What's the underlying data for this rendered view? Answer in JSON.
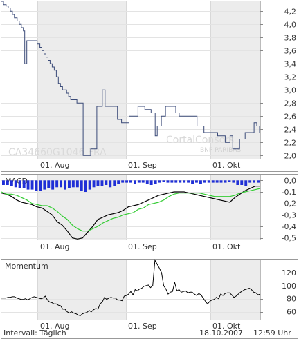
{
  "chart_data": [
    {
      "type": "line",
      "panel": "price",
      "instrument": "CA34660G1046",
      "exchange": "FRA",
      "x_labels": [
        "01. Aug",
        "01. Sep",
        "01. Okt"
      ],
      "y_ticks": [
        "4,2",
        "4,0",
        "3,8",
        "3,6",
        "3,4",
        "3,2",
        "3,0",
        "2,8",
        "2,6",
        "2,4",
        "2,2",
        "2,0"
      ],
      "ylim": [
        1.95,
        4.35
      ],
      "x": [
        0,
        1,
        2,
        3,
        4,
        5,
        6,
        7,
        8,
        9,
        10,
        11,
        12,
        13,
        14,
        15,
        16,
        17,
        18,
        19,
        20,
        21,
        22,
        23,
        24,
        25,
        26,
        27,
        28,
        29,
        30,
        31,
        32,
        33,
        34,
        35,
        36,
        37,
        38,
        39,
        40,
        41,
        42,
        43,
        44,
        45,
        46,
        47,
        48,
        49,
        50,
        51,
        52,
        53,
        54,
        55,
        56,
        57,
        58,
        59,
        60,
        61,
        62,
        63,
        64,
        65,
        66,
        67,
        68,
        69,
        70,
        71,
        72,
        73,
        74,
        75,
        76,
        77,
        78,
        79,
        80,
        81,
        82,
        83,
        84,
        85,
        86,
        87,
        88,
        89,
        90,
        91,
        92,
        93,
        94,
        95,
        96,
        97,
        98,
        99,
        100,
        101,
        102,
        103,
        104,
        105,
        106,
        107,
        108,
        109,
        110,
        111,
        112,
        113,
        114,
        115,
        116,
        117,
        118,
        119,
        120,
        121,
        122,
        123,
        124,
        125,
        126,
        127,
        128,
        129,
        130,
        131,
        132,
        133,
        134,
        135,
        136,
        137,
        138,
        139,
        140,
        141,
        142,
        143,
        144,
        145,
        146,
        147,
        148,
        149,
        150,
        151,
        152,
        153,
        154,
        155,
        156,
        157,
        158,
        159,
        160,
        161,
        162,
        163,
        164,
        165,
        166,
        167,
        168,
        169,
        170,
        171,
        172,
        173,
        174,
        175,
        176,
        177,
        178,
        179,
        180,
        181,
        182,
        183,
        184,
        185,
        186,
        187,
        188,
        189,
        190,
        191,
        192,
        193,
        194,
        195,
        196,
        197,
        198,
        199,
        200,
        201,
        202,
        203,
        204,
        205,
        206,
        207,
        208,
        209,
        210,
        211,
        212,
        213,
        214,
        215,
        216,
        217,
        218,
        219,
        220,
        221,
        222,
        223,
        224,
        225,
        226,
        227,
        228,
        229,
        230,
        231,
        232,
        233,
        234,
        235,
        236,
        237,
        238,
        239,
        240,
        241,
        242,
        243,
        244,
        245,
        246,
        247,
        248,
        249,
        250,
        251,
        252,
        253,
        254,
        255,
        256,
        257,
        258,
        259,
        260,
        261,
        262,
        263,
        264,
        265,
        266,
        267,
        268,
        269,
        270,
        271,
        272,
        273,
        274,
        275,
        276,
        277,
        278,
        279,
        280,
        281,
        282,
        283,
        284,
        285,
        286,
        287,
        288,
        289,
        290,
        291,
        292,
        293,
        294,
        295,
        296,
        297,
        298,
        299,
        300,
        301,
        302,
        303,
        304,
        305,
        306,
        307,
        308,
        309,
        310,
        311,
        312,
        313,
        314,
        315,
        316,
        317,
        318,
        319,
        320,
        321,
        322,
        323,
        324,
        325,
        326,
        327,
        328,
        329,
        330,
        331,
        332,
        333,
        334,
        335,
        336,
        337,
        338,
        339,
        340,
        341,
        342,
        343,
        344,
        345,
        346,
        347,
        348,
        349,
        350,
        351,
        352,
        353,
        354,
        355,
        356,
        357,
        358,
        359,
        360,
        361,
        362,
        363,
        364,
        365,
        366,
        367,
        368,
        369,
        370,
        371,
        372,
        373
      ],
      "values": [
        4.35,
        4.35,
        4.35,
        4.3,
        4.3,
        4.3,
        4.3,
        4.28,
        4.28,
        4.28,
        4.25,
        4.25,
        4.25,
        4.2,
        4.2,
        4.2,
        4.15,
        4.15,
        4.15,
        4.1,
        4.1,
        4.1,
        4.1,
        4.05,
        4.05,
        4.05,
        4.0,
        4.0,
        4.0,
        3.95,
        3.95,
        3.95,
        3.9,
        3.9,
        3.4,
        3.4,
        3.4,
        3.75,
        3.75,
        3.75,
        3.75,
        3.75,
        3.75,
        3.75,
        3.75,
        3.75,
        3.75,
        3.75,
        3.75,
        3.75,
        3.75,
        3.75,
        3.7,
        3.7,
        3.7,
        3.7,
        3.65,
        3.65,
        3.65,
        3.6,
        3.6,
        3.6,
        3.55,
        3.55,
        3.55,
        3.5,
        3.5,
        3.5,
        3.45,
        3.45,
        3.45,
        3.4,
        3.4,
        3.4,
        3.35,
        3.35,
        3.35,
        3.3,
        3.3,
        3.3,
        3.2,
        3.2,
        3.2,
        3.1,
        3.1,
        3.1,
        3.05,
        3.05,
        3.05,
        3.0,
        3.0,
        3.0,
        3.0,
        3.0,
        3.0,
        2.95,
        2.95,
        2.95,
        2.9,
        2.9,
        2.9,
        2.85,
        2.85,
        2.85,
        2.85,
        2.85,
        2.85,
        2.85,
        2.85,
        2.85,
        2.8,
        2.8,
        2.8,
        2.8,
        2.8,
        2.8,
        2.8,
        2.8,
        2.8,
        2.0,
        2.0,
        2.0,
        2.0,
        2.0,
        2.0,
        2.0,
        2.0,
        2.0,
        2.0,
        2.0,
        2.1,
        2.1,
        2.1,
        2.1,
        2.1,
        2.1,
        2.1,
        2.1,
        2.1,
        2.75,
        2.75,
        2.75,
        2.75,
        2.75,
        2.75,
        2.75,
        2.75,
        3.0,
        3.0,
        3.0,
        3.0,
        2.75,
        2.75,
        2.75,
        2.75,
        2.75,
        2.75,
        2.75,
        2.75,
        2.75,
        2.75,
        2.75,
        2.75,
        2.75,
        2.75,
        2.75,
        2.75,
        2.75,
        2.75,
        2.55,
        2.55,
        2.55,
        2.55,
        2.55,
        2.55,
        2.5,
        2.5,
        2.5,
        2.5,
        2.5,
        2.5,
        2.5,
        2.5,
        2.5,
        2.5,
        2.5,
        2.6,
        2.6,
        2.6,
        2.6,
        2.6,
        2.6,
        2.6,
        2.6,
        2.6,
        2.6,
        2.6,
        2.6,
        2.6,
        2.75,
        2.75,
        2.75,
        2.75,
        2.75,
        2.75,
        2.75,
        2.75,
        2.75,
        2.75,
        2.7,
        2.7,
        2.7,
        2.7,
        2.7,
        2.7,
        2.7,
        2.7,
        2.7,
        2.65,
        2.65,
        2.65,
        2.65,
        2.65,
        2.65,
        2.3,
        2.3,
        2.3,
        2.45,
        2.45,
        2.45,
        2.45,
        2.45,
        2.45,
        2.6,
        2.6,
        2.6,
        2.6,
        2.6,
        2.6,
        2.75,
        2.75,
        2.75,
        2.75,
        2.75,
        2.75,
        2.75,
        2.75,
        2.75,
        2.75,
        2.75,
        2.75,
        2.75,
        2.75,
        2.75,
        2.65,
        2.65,
        2.65,
        2.65,
        2.65,
        2.6,
        2.6,
        2.6,
        2.6,
        2.6,
        2.6,
        2.6,
        2.6,
        2.6,
        2.6,
        2.6,
        2.6,
        2.6,
        2.6,
        2.6,
        2.6,
        2.6,
        2.6,
        2.6,
        2.6,
        2.6,
        2.6,
        2.6,
        2.6,
        2.6,
        2.6,
        2.45,
        2.45,
        2.45,
        2.45,
        2.45,
        2.45,
        2.45,
        2.45,
        2.45,
        2.45,
        2.35,
        2.35,
        2.35,
        2.35,
        2.35,
        2.35,
        2.35,
        2.35,
        2.35,
        2.35,
        2.35,
        2.35,
        2.35,
        2.35,
        2.35,
        2.35,
        2.35,
        2.35,
        2.35,
        2.35,
        2.3,
        2.3,
        2.3,
        2.3,
        2.3,
        2.3,
        2.3,
        2.3,
        2.3,
        2.3,
        2.3,
        2.2,
        2.2,
        2.2,
        2.2,
        2.2,
        2.2,
        2.2,
        2.3,
        2.3,
        2.3,
        2.3,
        2.1,
        2.1,
        2.1,
        2.1,
        2.1,
        2.1,
        2.1,
        2.1,
        2.1,
        2.1,
        2.25,
        2.25,
        2.25,
        2.25,
        2.25,
        2.25,
        2.25,
        2.25,
        2.35,
        2.35,
        2.35,
        2.35,
        2.35,
        2.35,
        2.35,
        2.35,
        2.35,
        2.35,
        2.35,
        2.35,
        2.35,
        2.5,
        2.5,
        2.5,
        2.5,
        2.45,
        2.45,
        2.45,
        2.45,
        2.35,
        2.35
      ]
    },
    {
      "type": "bar+line",
      "panel": "macd",
      "title": "MACD",
      "y_ticks": [
        "0,0",
        "-0,1",
        "-0,2",
        "-0,3",
        "-0,4",
        "-0,5"
      ],
      "ylim": [
        -0.52,
        0.05
      ],
      "histogram": [
        -0.04,
        -0.04,
        -0.05,
        -0.06,
        -0.07,
        -0.07,
        -0.08,
        -0.08,
        -0.09,
        -0.09,
        -0.08,
        -0.07,
        -0.08,
        -0.06,
        -0.06,
        -0.08,
        -0.07,
        -0.06,
        -0.06,
        -0.09,
        -0.1,
        -0.08,
        -0.06,
        -0.05,
        -0.05,
        -0.04,
        -0.06,
        -0.05,
        -0.03,
        -0.02,
        -0.02,
        -0.02,
        -0.03,
        -0.02,
        -0.02,
        -0.03,
        -0.04,
        -0.03,
        -0.02,
        -0.01,
        -0.02,
        -0.02,
        -0.02,
        -0.02,
        -0.02,
        -0.02,
        -0.03,
        -0.02,
        -0.03,
        -0.02,
        -0.02,
        -0.02,
        -0.02,
        -0.02,
        -0.02,
        -0.01,
        -0.02,
        -0.04,
        -0.04,
        -0.05,
        -0.02,
        -0.02,
        -0.02
      ],
      "series": [
        {
          "name": "",
          "color": "#000000",
          "values": [
            -0.11,
            -0.12,
            -0.14,
            -0.17,
            -0.19,
            -0.2,
            -0.21,
            -0.23,
            -0.24,
            -0.27,
            -0.3,
            -0.36,
            -0.39,
            -0.44,
            -0.5,
            -0.51,
            -0.5,
            -0.45,
            -0.4,
            -0.34,
            -0.32,
            -0.3,
            -0.29,
            -0.28,
            -0.26,
            -0.23,
            -0.22,
            -0.21,
            -0.19,
            -0.17,
            -0.15,
            -0.13,
            -0.12,
            -0.11,
            -0.1,
            -0.1,
            -0.1,
            -0.11,
            -0.12,
            -0.13,
            -0.14,
            -0.15,
            -0.16,
            -0.17,
            -0.18,
            -0.19,
            -0.15,
            -0.12,
            -0.09,
            -0.07,
            -0.05,
            -0.05
          ]
        },
        {
          "name": "",
          "color": "#33cc33",
          "values": [
            -0.1,
            -0.12,
            -0.12,
            -0.13,
            -0.15,
            -0.17,
            -0.2,
            -0.21,
            -0.22,
            -0.22,
            -0.24,
            -0.27,
            -0.31,
            -0.34,
            -0.39,
            -0.42,
            -0.44,
            -0.44,
            -0.42,
            -0.4,
            -0.37,
            -0.35,
            -0.33,
            -0.32,
            -0.3,
            -0.29,
            -0.28,
            -0.25,
            -0.24,
            -0.21,
            -0.2,
            -0.19,
            -0.17,
            -0.14,
            -0.12,
            -0.11,
            -0.11,
            -0.11,
            -0.11,
            -0.11,
            -0.12,
            -0.13,
            -0.14,
            -0.14,
            -0.14,
            -0.14,
            -0.13,
            -0.11,
            -0.1,
            -0.09,
            -0.08,
            -0.07
          ]
        }
      ]
    },
    {
      "type": "line",
      "panel": "momentum",
      "title": "Momentum",
      "y_ticks": [
        "120",
        "100",
        "80",
        "60"
      ],
      "ylim": [
        48,
        140
      ],
      "values": [
        81,
        81,
        81,
        82,
        82,
        83,
        83,
        81,
        80,
        79,
        79,
        80,
        78,
        80,
        82,
        83,
        82,
        81,
        80,
        81,
        84,
        78,
        75,
        74,
        72,
        72,
        70,
        69,
        64,
        64,
        60,
        58,
        60,
        58,
        57,
        55,
        54,
        57,
        58,
        59,
        62,
        60,
        63,
        65,
        64,
        72,
        75,
        82,
        79,
        81,
        82,
        81,
        81,
        78,
        78,
        77,
        84,
        85,
        87,
        91,
        86,
        94,
        92,
        95,
        96,
        99,
        100,
        101,
        97,
        100,
        139,
        133,
        127,
        120,
        100,
        95,
        87,
        90,
        91,
        105,
        92,
        94,
        90,
        91,
        92,
        89,
        90,
        90,
        87,
        85,
        88,
        86,
        81,
        76,
        72,
        76,
        78,
        79,
        82,
        80,
        87,
        85,
        88,
        89,
        89,
        86,
        82,
        84,
        87,
        90,
        92,
        94,
        95,
        96,
        94,
        90,
        89,
        86,
        87
      ]
    }
  ],
  "footer": {
    "left": "Intervall: Täglich",
    "date": "18.10.2007",
    "time": "12:59 Uhr"
  },
  "watermark": {
    "brand": "CortalConsors",
    "sub": "BNP PARIBAS"
  }
}
